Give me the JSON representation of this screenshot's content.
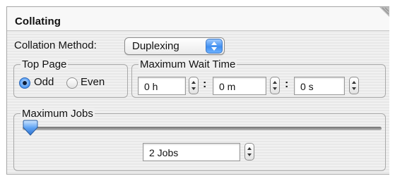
{
  "panel": {
    "title": "Collating"
  },
  "collation": {
    "label": "Collation Method:",
    "selected": "Duplexing"
  },
  "top_page": {
    "label": "Top Page",
    "options": [
      {
        "label": "Odd",
        "selected": true
      },
      {
        "label": "Even",
        "selected": false
      }
    ]
  },
  "wait_time": {
    "label": "Maximum Wait Time",
    "hours": "0 h",
    "minutes": "0 m",
    "seconds": "0 s",
    "separator": ":"
  },
  "max_jobs": {
    "label": "Maximum Jobs",
    "value": "2 Jobs",
    "slider_fraction": 0.0
  },
  "colors": {
    "accent": "#3f8ef0",
    "panel_background": "#eeeeee"
  }
}
